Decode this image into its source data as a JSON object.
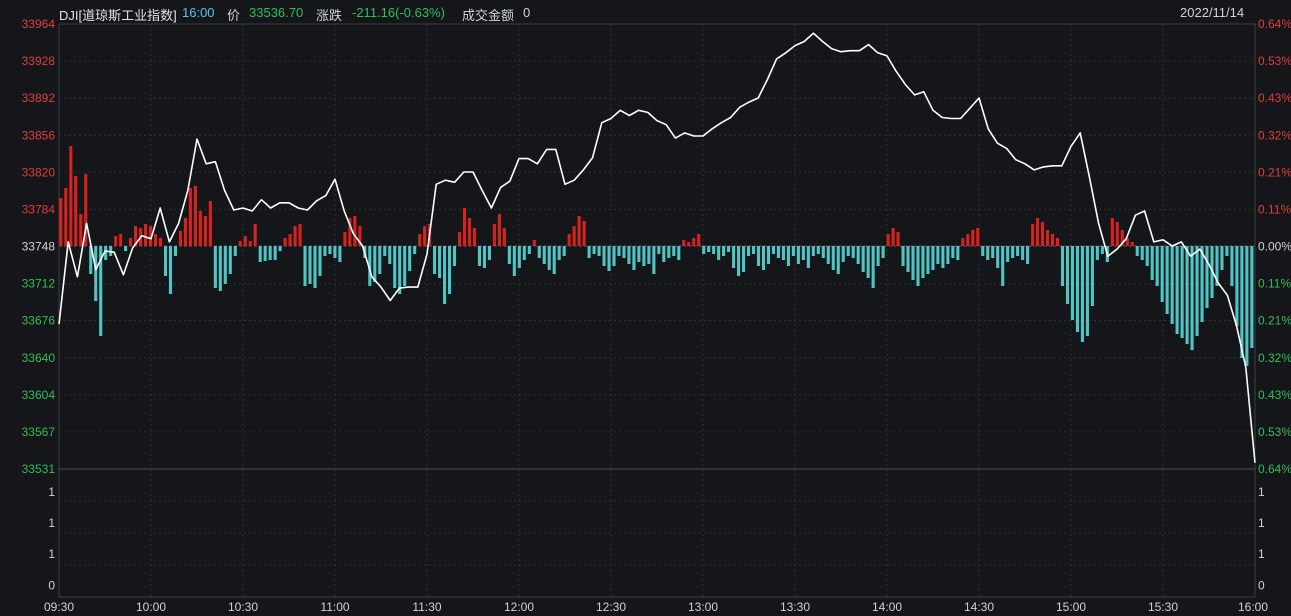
{
  "header": {
    "symbol": "DJI[道琼斯工业指数]",
    "time": "16:00",
    "price_label": "价",
    "price": "33536.70",
    "change_label": "涨跌",
    "change": "-211.16(-0.63%)",
    "turnover_label": "成交金额",
    "turnover": "0",
    "date": "2022/11/14"
  },
  "colors": {
    "background": "#141619",
    "up": "#d7221f",
    "down": "#4fc6c6",
    "line": "#ffffff",
    "time_text": "#56c6f0",
    "price_text": "#27c15f",
    "up_text": "#e23b3b",
    "down_text": "#2ebd59",
    "grid": "#2e3237"
  },
  "chart_data": {
    "type": "line",
    "title": "DJI[道琼斯工业指数]",
    "x_ticks": [
      "09:30",
      "10:00",
      "10:30",
      "11:00",
      "11:30",
      "12:00",
      "12:30",
      "13:00",
      "13:30",
      "14:00",
      "14:30",
      "15:00",
      "15:30",
      "16:00"
    ],
    "price_ticks": [
      "33964",
      "33928",
      "33892",
      "33856",
      "33820",
      "33784",
      "33748",
      "33712",
      "33676",
      "33640",
      "33604",
      "33567",
      "33531"
    ],
    "pct_ticks": [
      "0.64%",
      "0.53%",
      "0.43%",
      "0.32%",
      "0.21%",
      "0.11%",
      "0.00%",
      "0.11%",
      "0.21%",
      "0.32%",
      "0.43%",
      "0.53%",
      "0.64%"
    ],
    "volume_ticks": [
      "1",
      "1",
      "1",
      "0"
    ],
    "baseline": 33748,
    "ylim": [
      33531,
      33964
    ],
    "series": [
      {
        "type": "line",
        "points": [
          [
            "09:30",
            33672
          ],
          [
            "09:33",
            33752
          ],
          [
            "09:36",
            33718
          ],
          [
            "09:39",
            33770
          ],
          [
            "09:42",
            33725
          ],
          [
            "09:45",
            33743
          ],
          [
            "09:48",
            33742
          ],
          [
            "09:51",
            33720
          ],
          [
            "09:54",
            33746
          ],
          [
            "09:57",
            33758
          ],
          [
            "10:00",
            33755
          ],
          [
            "10:03",
            33785
          ],
          [
            "10:06",
            33752
          ],
          [
            "10:09",
            33770
          ],
          [
            "10:12",
            33802
          ],
          [
            "10:15",
            33852
          ],
          [
            "10:18",
            33828
          ],
          [
            "10:21",
            33830
          ],
          [
            "10:24",
            33802
          ],
          [
            "10:27",
            33783
          ],
          [
            "10:30",
            33785
          ],
          [
            "10:33",
            33782
          ],
          [
            "10:36",
            33793
          ],
          [
            "10:39",
            33785
          ],
          [
            "10:42",
            33790
          ],
          [
            "10:45",
            33790
          ],
          [
            "10:48",
            33785
          ],
          [
            "10:51",
            33783
          ],
          [
            "10:54",
            33792
          ],
          [
            "10:57",
            33797
          ],
          [
            "11:00",
            33813
          ],
          [
            "11:03",
            33782
          ],
          [
            "11:06",
            33760
          ],
          [
            "11:09",
            33748
          ],
          [
            "11:12",
            33718
          ],
          [
            "11:15",
            33708
          ],
          [
            "11:18",
            33695
          ],
          [
            "11:21",
            33707
          ],
          [
            "11:24",
            33708
          ],
          [
            "11:27",
            33708
          ],
          [
            "11:30",
            33740
          ],
          [
            "11:33",
            33808
          ],
          [
            "11:36",
            33812
          ],
          [
            "11:39",
            33810
          ],
          [
            "11:42",
            33820
          ],
          [
            "11:45",
            33820
          ],
          [
            "11:48",
            33802
          ],
          [
            "11:51",
            33785
          ],
          [
            "11:54",
            33805
          ],
          [
            "11:57",
            33811
          ],
          [
            "12:00",
            33833
          ],
          [
            "12:03",
            33833
          ],
          [
            "12:06",
            33828
          ],
          [
            "12:09",
            33842
          ],
          [
            "12:12",
            33842
          ],
          [
            "12:15",
            33808
          ],
          [
            "12:18",
            33812
          ],
          [
            "12:21",
            33822
          ],
          [
            "12:24",
            33834
          ],
          [
            "12:27",
            33868
          ],
          [
            "12:30",
            33872
          ],
          [
            "12:33",
            33880
          ],
          [
            "12:36",
            33875
          ],
          [
            "12:39",
            33880
          ],
          [
            "12:42",
            33878
          ],
          [
            "12:45",
            33870
          ],
          [
            "12:48",
            33866
          ],
          [
            "12:51",
            33853
          ],
          [
            "12:54",
            33858
          ],
          [
            "12:57",
            33855
          ],
          [
            "13:00",
            33855
          ],
          [
            "13:03",
            33862
          ],
          [
            "13:06",
            33868
          ],
          [
            "13:09",
            33873
          ],
          [
            "13:12",
            33883
          ],
          [
            "13:15",
            33888
          ],
          [
            "13:18",
            33892
          ],
          [
            "13:21",
            33910
          ],
          [
            "13:24",
            33930
          ],
          [
            "13:27",
            33936
          ],
          [
            "13:30",
            33943
          ],
          [
            "13:33",
            33947
          ],
          [
            "13:36",
            33955
          ],
          [
            "13:39",
            33947
          ],
          [
            "13:42",
            33940
          ],
          [
            "13:45",
            33937
          ],
          [
            "13:48",
            33938
          ],
          [
            "13:51",
            33938
          ],
          [
            "13:54",
            33944
          ],
          [
            "13:57",
            33936
          ],
          [
            "14:00",
            33933
          ],
          [
            "14:03",
            33918
          ],
          [
            "14:06",
            33905
          ],
          [
            "14:09",
            33895
          ],
          [
            "14:12",
            33898
          ],
          [
            "14:15",
            33880
          ],
          [
            "14:18",
            33873
          ],
          [
            "14:21",
            33872
          ],
          [
            "14:24",
            33872
          ],
          [
            "14:27",
            33882
          ],
          [
            "14:30",
            33892
          ],
          [
            "14:33",
            33862
          ],
          [
            "14:36",
            33848
          ],
          [
            "14:39",
            33843
          ],
          [
            "14:42",
            33832
          ],
          [
            "14:45",
            33828
          ],
          [
            "14:48",
            33822
          ],
          [
            "14:51",
            33825
          ],
          [
            "14:54",
            33826
          ],
          [
            "14:57",
            33826
          ],
          [
            "15:00",
            33845
          ],
          [
            "15:03",
            33858
          ],
          [
            "15:06",
            33815
          ],
          [
            "15:09",
            33770
          ],
          [
            "15:12",
            33738
          ],
          [
            "15:15",
            33745
          ],
          [
            "15:18",
            33755
          ],
          [
            "15:21",
            33778
          ],
          [
            "15:24",
            33782
          ],
          [
            "15:27",
            33752
          ],
          [
            "15:30",
            33754
          ],
          [
            "15:33",
            33748
          ],
          [
            "15:36",
            33752
          ],
          [
            "15:39",
            33738
          ],
          [
            "15:42",
            33745
          ],
          [
            "15:45",
            33730
          ],
          [
            "15:48",
            33712
          ],
          [
            "15:51",
            33700
          ],
          [
            "15:54",
            33670
          ],
          [
            "15:57",
            33630
          ],
          [
            "16:00",
            33537
          ]
        ]
      },
      {
        "type": "bar",
        "values": [
          [
            48,
            58,
            100,
            70,
            32,
            72,
            -28,
            -55,
            -90,
            -14,
            -10,
            10,
            12,
            -5,
            8,
            20,
            18,
            22,
            20,
            12,
            8,
            -30,
            -48,
            -10,
            15,
            28,
            58,
            60,
            35,
            30,
            45,
            -42,
            -45,
            -38,
            -28,
            -10,
            5,
            10,
            5,
            22,
            -16,
            -15,
            -14,
            -14,
            -5,
            8,
            12,
            20,
            22,
            -40,
            -38,
            -42,
            -30,
            -10,
            -8,
            -12,
            -16,
            14,
            28,
            30,
            20,
            -12,
            -40,
            -36,
            -28,
            -10,
            -18,
            -42,
            -48,
            -40,
            -25,
            -8,
            12,
            20,
            22,
            -28,
            -32,
            -58,
            -48,
            -20
          ],
          [
            14,
            38,
            28,
            18,
            -20,
            -22,
            -14,
            22,
            32,
            18,
            -18,
            -30,
            -22,
            -14,
            -8,
            6,
            -12,
            -18,
            -24,
            -28,
            -14,
            -10,
            12,
            20,
            30,
            25,
            -12,
            -8,
            -10,
            -20,
            -25,
            -20,
            -10,
            -12,
            -18,
            -24,
            -16,
            -20,
            -18,
            -28,
            -8,
            -16,
            -12,
            -10,
            -14,
            6,
            4,
            8,
            12,
            -8,
            -6,
            -8,
            -14,
            -10,
            -6,
            -22,
            -30,
            -26,
            -10,
            -8,
            -20,
            -24,
            -18,
            -8,
            -12,
            -14,
            -20,
            -10,
            -18,
            -14,
            -22,
            -10,
            -8,
            -12,
            -18,
            -24,
            -28,
            -16,
            -10,
            -12
          ],
          [
            -18,
            -26,
            -32,
            -42,
            -20,
            -12,
            12,
            18,
            14,
            -20,
            -26,
            -34,
            -40,
            -32,
            -28,
            -24,
            -18,
            -22,
            -18,
            -12,
            -14,
            8,
            12,
            16,
            18,
            -10,
            -14,
            -12,
            -22,
            -40,
            -16,
            -12,
            -10,
            -14,
            -18,
            22,
            28,
            24,
            16,
            12,
            8,
            -40,
            -58,
            -74,
            -86,
            -96,
            -90,
            -60,
            -14,
            -8,
            -16,
            28,
            24,
            16,
            8,
            4,
            -10,
            -14,
            -20,
            -34,
            -40,
            -56,
            -68,
            -78,
            -88,
            -92,
            -98,
            -104,
            -90,
            -76,
            -62,
            -52,
            -40,
            -24,
            -10,
            -40,
            -80,
            -112,
            -120,
            -102
          ]
        ]
      }
    ]
  }
}
